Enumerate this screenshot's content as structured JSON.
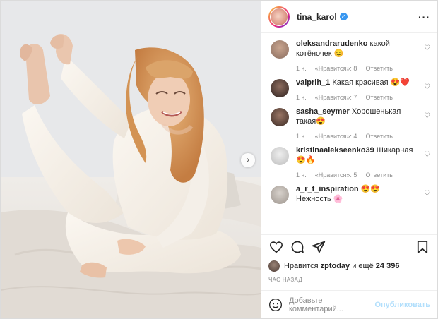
{
  "post": {
    "username": "tina_karol",
    "verified": true,
    "more_icon": "ellipsis-icon",
    "carousel_next_icon": "chevron-right-icon"
  },
  "comments": [
    {
      "user": "oleksandrarudenko",
      "text": "какой котёночек 😊",
      "time": "1 ч.",
      "likes": "«Нравится»: 8",
      "reply": "Ответить",
      "avatar_color": "#8a6d5f"
    },
    {
      "user": "valprih_1",
      "text": "Какая красивая 😍❤️",
      "time": "1 ч.",
      "likes": "«Нравится»: 7",
      "reply": "Ответить",
      "avatar_color": "#3b2b27"
    },
    {
      "user": "sasha_seymer",
      "text": "Хорошенькая такая😍",
      "time": "1 ч.",
      "likes": "«Нравится»: 4",
      "reply": "Ответить",
      "avatar_color": "#4a342c"
    },
    {
      "user": "kristinaalekseenko39",
      "text": "Шикарная 😍🔥",
      "time": "1 ч.",
      "likes": "«Нравится»: 5",
      "reply": "Ответить",
      "avatar_color": "#cfcfcf"
    },
    {
      "user": "a_r_t_inspiration",
      "text": "😍😍 Нежность 🌸",
      "time": "",
      "likes": "",
      "reply": "",
      "avatar_color": "#b5aea8"
    }
  ],
  "actions": {
    "like_icon": "heart-icon",
    "comment_icon": "comment-icon",
    "share_icon": "share-icon",
    "save_icon": "bookmark-icon"
  },
  "likes": {
    "prefix": "Нравится",
    "user": "zptoday",
    "middle": "и ещё",
    "count": "24 396"
  },
  "timestamp": "ЧАС НАЗАД",
  "add_comment": {
    "emoji_icon": "smiley-icon",
    "placeholder": "Добавьте комментарий...",
    "publish": "Опубликовать"
  },
  "colors": {
    "accent": "#0095f6",
    "publish_disabled": "#b2dffc",
    "muted": "#8e8e8e",
    "border": "#efefef"
  }
}
